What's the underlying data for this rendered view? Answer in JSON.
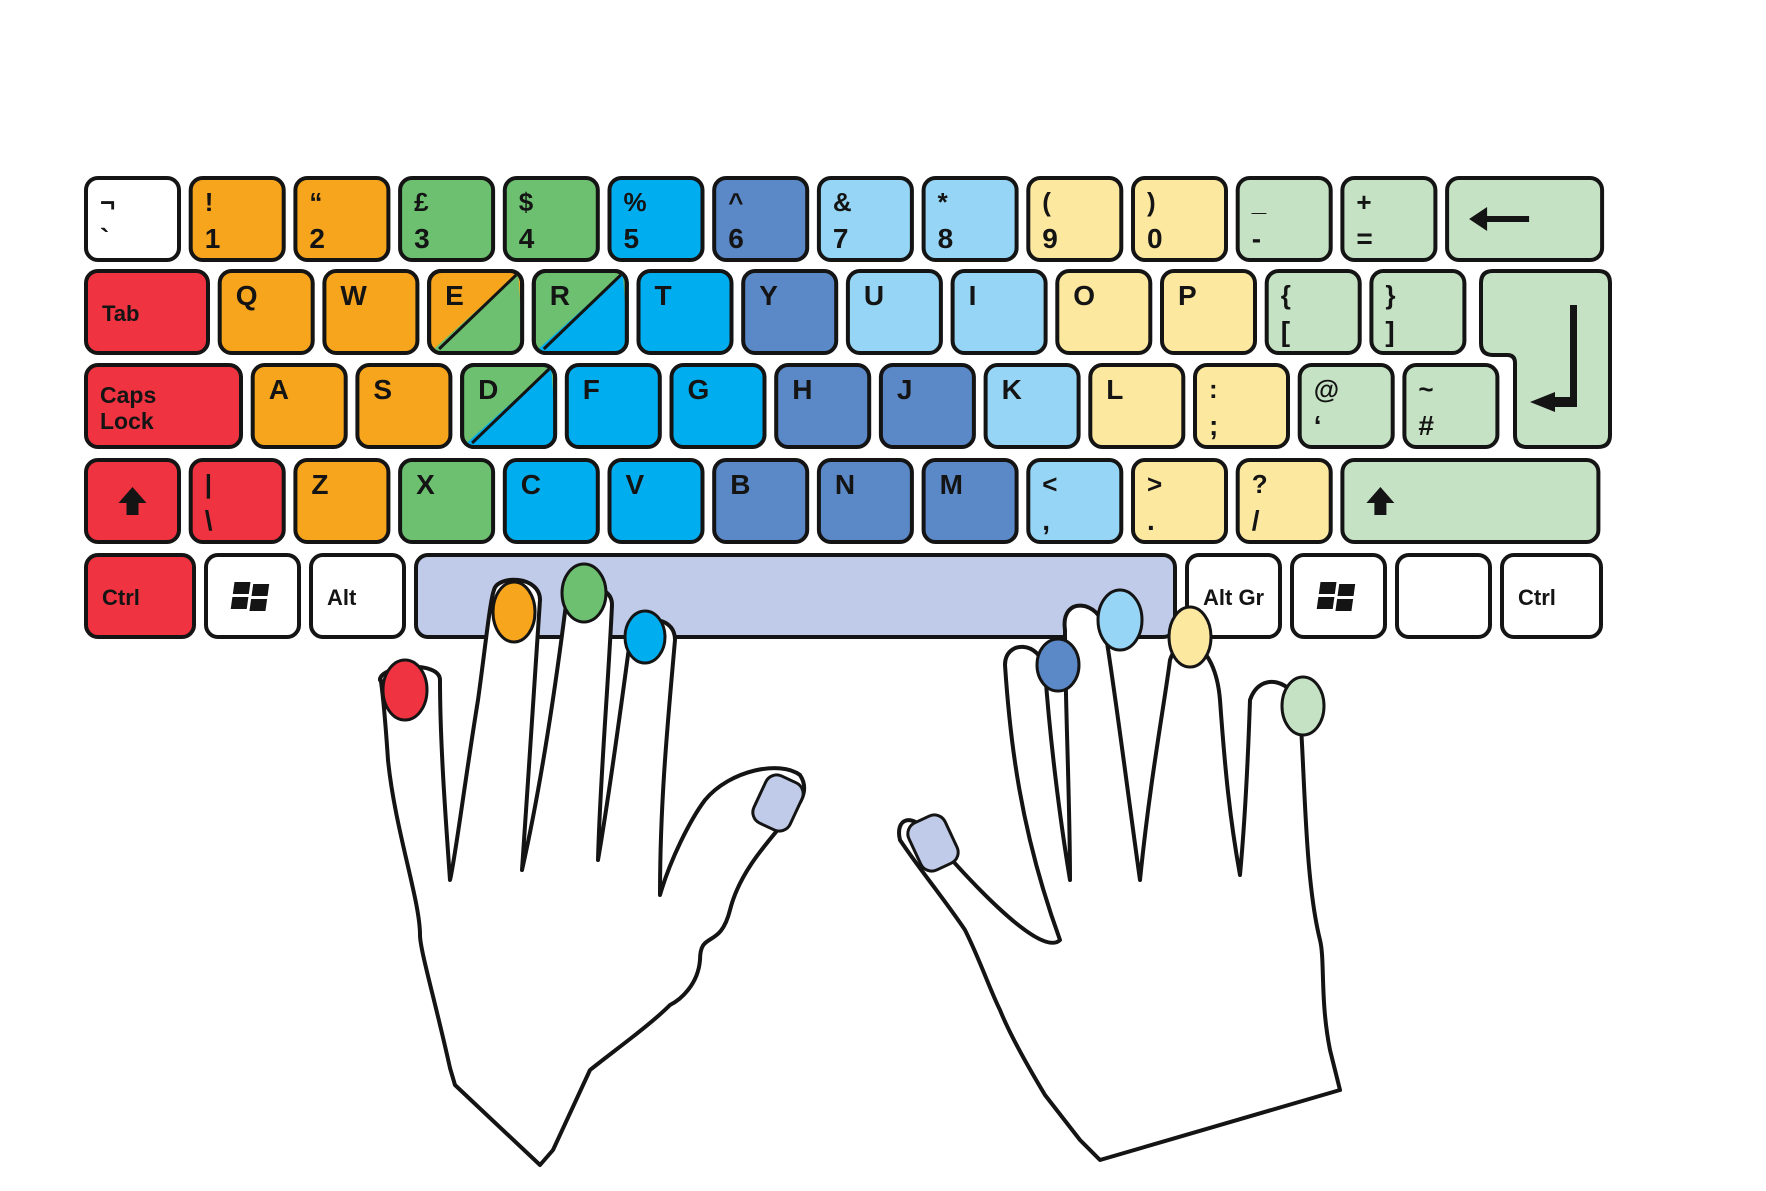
{
  "colors": {
    "pinky_left": "#ef3340",
    "ring_left": "#f7a51d",
    "middle_left": "#6cc070",
    "index_left": "#00aeef",
    "index_right": "#5b88c6",
    "middle_right": "#96d5f5",
    "ring_right": "#fde8a0",
    "pinky_right": "#c5e3c4",
    "thumbs": "#bfcbe8",
    "neutral": "#ffffff"
  },
  "keyboard": {
    "rows": [
      [
        {
          "top": "¬",
          "bottom": "`",
          "color": "neutral"
        },
        {
          "top": "!",
          "bottom": "1",
          "color": "ring_left"
        },
        {
          "top": "“",
          "bottom": "2",
          "color": "ring_left"
        },
        {
          "top": "£",
          "bottom": "3",
          "color": "middle_left"
        },
        {
          "top": "$",
          "bottom": "4",
          "color": "middle_left"
        },
        {
          "top": "%",
          "bottom": "5",
          "color": "index_left"
        },
        {
          "top": "^",
          "bottom": "6",
          "color": "index_right"
        },
        {
          "top": "&",
          "bottom": "7",
          "color": "middle_right"
        },
        {
          "top": "*",
          "bottom": "8",
          "color": "middle_right"
        },
        {
          "top": "(",
          "bottom": "9",
          "color": "ring_right"
        },
        {
          "top": ")",
          "bottom": "0",
          "color": "ring_right"
        },
        {
          "top": "_",
          "bottom": "-",
          "color": "pinky_right"
        },
        {
          "top": "+",
          "bottom": "=",
          "color": "pinky_right"
        },
        {
          "icon": "backspace-arrow-icon",
          "color": "pinky_right"
        }
      ],
      [
        {
          "label": "Tab",
          "color": "pinky_left"
        },
        {
          "label": "Q",
          "color": "ring_left"
        },
        {
          "label": "W",
          "color": "ring_left"
        },
        {
          "label": "E",
          "color": "ring_left",
          "split_color": "middle_left"
        },
        {
          "label": "R",
          "color": "middle_left",
          "split_color": "index_left"
        },
        {
          "label": "T",
          "color": "index_left"
        },
        {
          "label": "Y",
          "color": "index_right"
        },
        {
          "label": "U",
          "color": "middle_right"
        },
        {
          "label": "I",
          "color": "middle_right"
        },
        {
          "label": "O",
          "color": "ring_right"
        },
        {
          "label": "P",
          "color": "ring_right"
        },
        {
          "top": "{",
          "bottom": "[",
          "color": "pinky_right"
        },
        {
          "top": "}",
          "bottom": "]",
          "color": "pinky_right"
        }
      ],
      [
        {
          "label": "Caps\nLock",
          "label_line1": "Caps",
          "label_line2": "Lock",
          "color": "pinky_left"
        },
        {
          "label": "A",
          "color": "ring_left"
        },
        {
          "label": "S",
          "color": "ring_left"
        },
        {
          "label": "D",
          "color": "middle_left",
          "split_color": "index_left"
        },
        {
          "label": "F",
          "color": "index_left"
        },
        {
          "label": "G",
          "color": "index_left"
        },
        {
          "label": "H",
          "color": "index_right"
        },
        {
          "label": "J",
          "color": "index_right"
        },
        {
          "label": "K",
          "color": "middle_right"
        },
        {
          "label": "L",
          "color": "ring_right"
        },
        {
          "top": ":",
          "bottom": ";",
          "color": "ring_right"
        },
        {
          "top": "@",
          "bottom": "‘",
          "color": "pinky_right"
        },
        {
          "top": "~",
          "bottom": "#",
          "color": "pinky_right"
        }
      ],
      [
        {
          "icon": "shift-arrow-icon",
          "color": "pinky_left"
        },
        {
          "top": "|",
          "bottom": "\\",
          "color": "pinky_left"
        },
        {
          "label": "Z",
          "color": "ring_left"
        },
        {
          "label": "X",
          "color": "middle_left"
        },
        {
          "label": "C",
          "color": "index_left"
        },
        {
          "label": "V",
          "color": "index_left"
        },
        {
          "label": "B",
          "color": "index_right"
        },
        {
          "label": "N",
          "color": "index_right"
        },
        {
          "label": "M",
          "color": "index_right"
        },
        {
          "top": "<",
          "bottom": ",",
          "color": "middle_right"
        },
        {
          "top": ">",
          "bottom": ".",
          "color": "ring_right"
        },
        {
          "top": "?",
          "bottom": "/",
          "color": "ring_right"
        },
        {
          "icon": "shift-arrow-icon",
          "color": "pinky_right"
        }
      ],
      [
        {
          "label": "Ctrl",
          "color": "pinky_left"
        },
        {
          "icon": "windows-logo-icon",
          "color": "neutral"
        },
        {
          "label": "Alt",
          "color": "neutral"
        },
        {
          "label": "",
          "color": "thumbs"
        },
        {
          "label": "Alt Gr",
          "color": "neutral"
        },
        {
          "icon": "windows-logo-icon",
          "color": "neutral"
        },
        {
          "label": "",
          "color": "neutral"
        },
        {
          "label": "Ctrl",
          "color": "neutral"
        }
      ]
    ],
    "enter": {
      "icon": "enter-arrow-icon",
      "color": "pinky_right"
    }
  }
}
